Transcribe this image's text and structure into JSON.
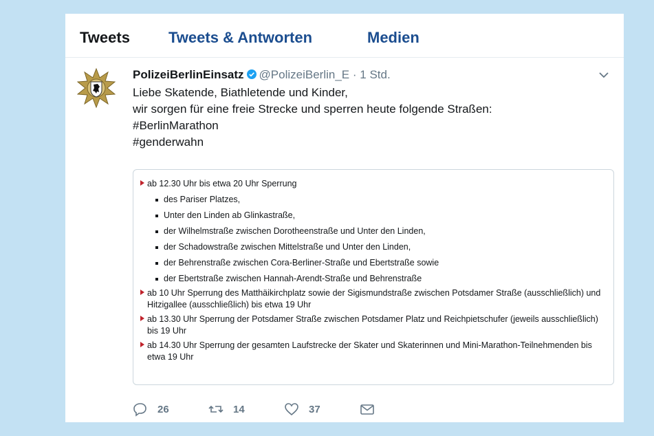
{
  "tabs": [
    {
      "label": "Tweets"
    },
    {
      "label": "Tweets & Antworten"
    },
    {
      "label": "Medien"
    }
  ],
  "tweet": {
    "author_name": "PolizeiBerlinEinsatz",
    "handle": "@PolizeiBerlin_E",
    "separator": "·",
    "time": "1 Std.",
    "lines": [
      "Liebe Skatende, Biathletende und Kinder,",
      "wir sorgen für eine freie Strecke und sperren heute folgende Straßen:",
      "#BerlinMarathon",
      "#genderwahn"
    ]
  },
  "embed": {
    "items": [
      {
        "text": "ab 12.30 Uhr bis etwa 20 Uhr Sperrung",
        "subitems": [
          "des Pariser Platzes,",
          "Unter den Linden ab Glinkastraße,",
          "der Wilhelmstraße zwischen Dorotheenstraße und Unter den Linden,",
          "der Schadowstraße zwischen Mittelstraße und Unter den Linden,",
          "der Behrenstraße zwischen Cora-Berliner-Straße und Ebertstraße sowie",
          "der Ebertstraße zwischen Hannah-Arendt-Straße und Behrenstraße"
        ]
      },
      {
        "text": "ab 10 Uhr Sperrung des Matthäikirchplatz sowie der Sigismundstraße zwischen Potsdamer Straße (ausschließlich) und Hitzigallee (ausschließlich) bis etwa 19 Uhr"
      },
      {
        "text": "ab 13.30 Uhr Sperrung der Potsdamer Straße zwischen Potsdamer Platz und Reichpietschufer (jeweils ausschließlich) bis 19 Uhr"
      },
      {
        "text": "ab 14.30 Uhr Sperrung der gesamten Laufstrecke der Skater und Skaterinnen und Mini-Marathon-Teilnehmenden bis etwa 19 Uhr"
      }
    ]
  },
  "actions": {
    "reply_count": "26",
    "retweet_count": "14",
    "like_count": "37"
  },
  "icons": {
    "reply": "reply-icon",
    "retweet": "retweet-icon",
    "like": "heart-icon",
    "dm": "envelope-icon",
    "verified": "verified-badge-icon",
    "menu": "chevron-down-icon"
  },
  "colors": {
    "background": "#c3e1f3",
    "tab_accent": "#1b4d8f",
    "verified": "#1da1f2",
    "bullet_red": "#c0232c",
    "muted": "#657786"
  }
}
